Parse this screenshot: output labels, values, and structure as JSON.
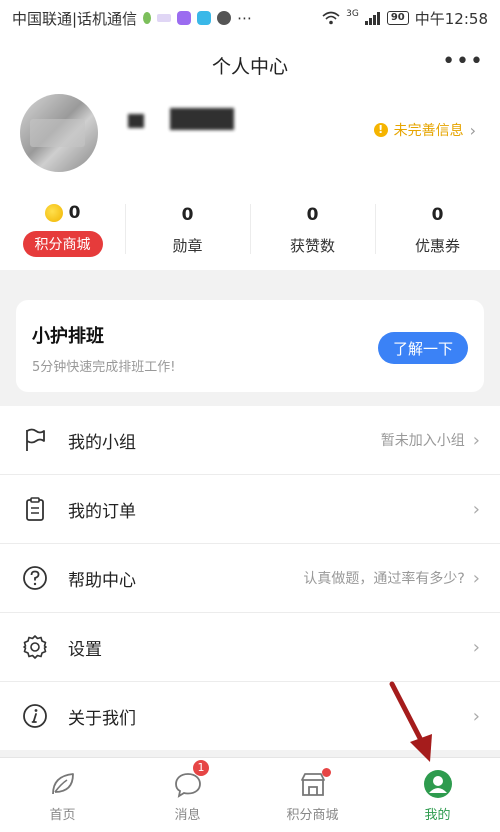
{
  "status_bar": {
    "carrier": "中国联通|话机通信",
    "time": "中午12:58",
    "battery": "90",
    "network": "3G",
    "more_glyph": "⋯"
  },
  "header": {
    "title": "个人中心",
    "more_glyph": "•••"
  },
  "profile": {
    "incomplete_text": "未完善信息",
    "warn_glyph": "!",
    "chevron": "›"
  },
  "stats": [
    {
      "value": "0",
      "label": "积分商城"
    },
    {
      "value": "0",
      "label": "勋章"
    },
    {
      "value": "0",
      "label": "获赞数"
    },
    {
      "value": "0",
      "label": "优惠券"
    }
  ],
  "banner": {
    "title": "小护排班",
    "subtitle": "5分钟快速完成排班工作!",
    "button": "了解一下"
  },
  "menu": [
    {
      "label": "我的小组",
      "hint": "暂未加入小组",
      "icon": "flag-icon"
    },
    {
      "label": "我的订单",
      "hint": "",
      "icon": "clipboard-icon"
    },
    {
      "label": "帮助中心",
      "hint": "认真做题，通过率有多少?",
      "icon": "help-icon"
    },
    {
      "label": "设置",
      "hint": "",
      "icon": "gear-icon"
    },
    {
      "label": "关于我们",
      "hint": "",
      "icon": "info-icon"
    }
  ],
  "menu_chevron": "›",
  "nav": [
    {
      "label": "首页",
      "icon": "leaf-icon"
    },
    {
      "label": "消息",
      "icon": "chat-icon",
      "badge": "1"
    },
    {
      "label": "积分商城",
      "icon": "store-icon"
    },
    {
      "label": "我的",
      "icon": "profile-icon",
      "active": true
    }
  ],
  "colors": {
    "accent_green": "#2e9b4e",
    "mall_red": "#e63b3b",
    "button_blue": "#3b82f6",
    "warning_yellow": "#f5b400"
  }
}
